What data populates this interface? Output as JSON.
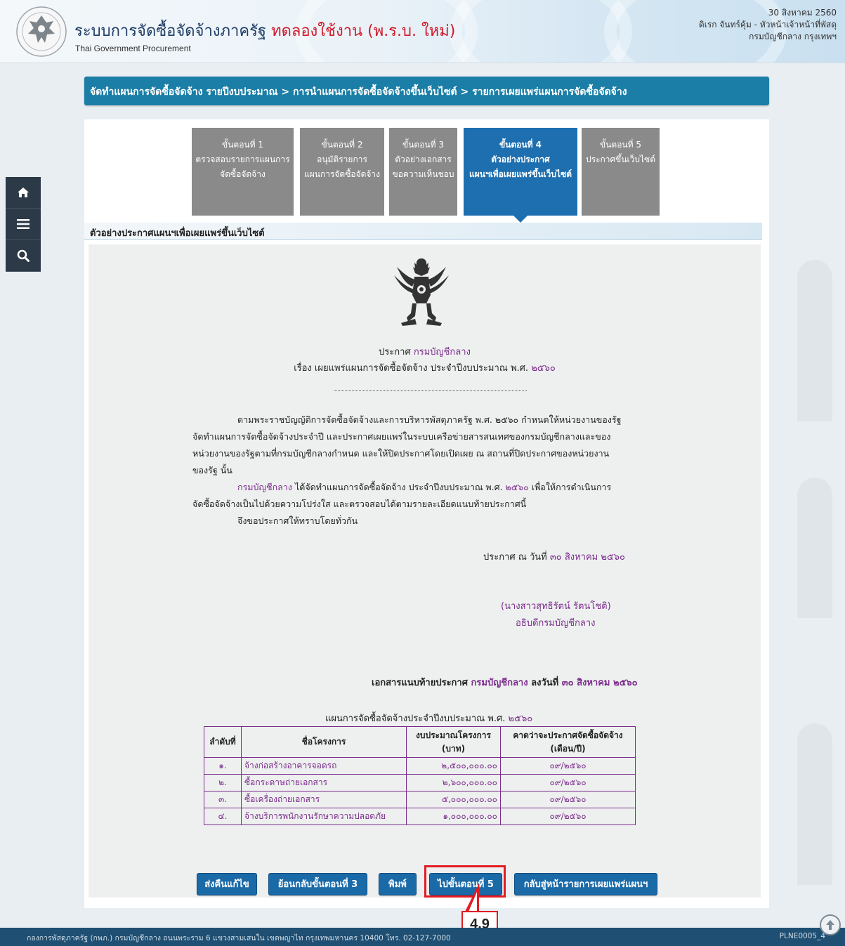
{
  "header": {
    "title": "ระบบการจัดซื้อจัดจ้างภาครัฐ",
    "trial_label": "ทดลองใช้งาน (พ.ร.บ. ใหม่)",
    "subtitle": "Thai Government Procurement",
    "date": "30 สิงหาคม 2560",
    "user": "ดิเรก จันทร์คุ้ม - หัวหน้าเจ้าหน้าที่พัสดุ",
    "org": "กรมบัญชีกลาง กรุงเทพฯ"
  },
  "nav": {
    "home_icon": "home-icon",
    "menu_icon": "menu-icon",
    "search_icon": "search-icon"
  },
  "breadcrumb": "จัดทำแผนการจัดซื้อจัดจ้าง รายปีงบประมาณ > การนำแผนการจัดซื้อจัดจ้างขึ้นเว็บไซต์ > รายการเผยแพร่แผนการจัดซื้อจัดจ้าง",
  "steps": [
    {
      "title": "ขั้นตอนที่ 1",
      "line1": "ตรวจสอบรายการแผนการ",
      "line2": "จัดซื้อจัดจ้าง"
    },
    {
      "title": "ขั้นตอนที่ 2",
      "line1": "อนุมัติรายการ",
      "line2": "แผนการจัดซื้อจัดจ้าง"
    },
    {
      "title": "ขั้นตอนที่ 3",
      "line1": "ตัวอย่างเอกสาร",
      "line2": "ขอความเห็นชอบ"
    },
    {
      "title": "ขั้นตอนที่ 4",
      "line1": "ตัวอย่างประกาศ",
      "line2": "แผนฯเพื่อเผยแพร่ขึ้นเว็บไซต์"
    },
    {
      "title": "ขั้นตอนที่ 5",
      "line1": "ประกาศขึ้นเว็บไซต์",
      "line2": ""
    }
  ],
  "section_title": "ตัวอย่างประกาศแผนฯเพื่อเผยแพร่ขึ้นเว็บไซต์",
  "doc": {
    "announce_prefix": "ประกาศ",
    "agency": "กรมบัญชีกลาง",
    "subject": "เรื่อง เผยแพร่แผนการจัดซื้อจัดจ้าง ประจำปีงบประมาณ พ.ศ.",
    "year": "๒๕๖๐",
    "p1_l1": "ตามพระราชบัญญัติการจัดซื้อจัดจ้างและการบริหารพัสดุภาครัฐ พ.ศ. ๒๕๖๐ กำหนดให้หน่วยงานของรัฐ",
    "p1_l2": "จัดทำแผนการจัดซื้อจัดจ้างประจำปี และประกาศเผยแพร่ในระบบเครือข่ายสารสนเทศของกรมบัญชีกลางและของ",
    "p1_l3": "หน่วยงานของรัฐตามที่กรมบัญชีกลางกำหนด และให้ปิดประกาศโดยเปิดเผย ณ สถานที่ปิดประกาศของหน่วยงาน",
    "p1_l4": "ของรัฐ นั้น",
    "p2_agency": "กรมบัญชีกลาง",
    "p2_l1": "ได้จัดทำแผนการจัดซื้อจัดจ้าง ประจำปีงบประมาณ พ.ศ.",
    "p2_year": "๒๕๖๐",
    "p2_l1_end": "เพื่อให้การดำเนินการ",
    "p2_l2": "จัดซื้อจัดจ้างเป็นไปด้วยความโปร่งใส และตรวจสอบได้ตามรายละเอียดแนบท้ายประกาศนี้",
    "p3": "จึงขอประกาศให้ทราบโดยทั่วกัน",
    "date_prefix": "ประกาศ ณ วันที่",
    "date_value": "๓๐ สิงหาคม ๒๕๖๐",
    "signer_name": "(นางสาวสุทธิรัตน์ รัตนโชติ)",
    "signer_title": "อธิบดีกรมบัญชีกลาง",
    "attach_prefix": "เอกสารแนบท้ายประกาศ",
    "attach_agency": "กรมบัญชีกลาง",
    "attach_date_prefix": "ลงวันที่",
    "attach_date": "๓๐ สิงหาคม ๒๕๖๐",
    "table_title": "แผนการจัดซื้อจัดจ้างประจำปีงบประมาณ พ.ศ.",
    "table_year": "๒๕๖๐"
  },
  "table": {
    "headers": {
      "no": "ลำดับที่",
      "name": "ชื่อโครงการ",
      "budget_l1": "งบประมาณโครงการ",
      "budget_l2": "(บาท)",
      "expected_l1": "คาดว่าจะประกาศจัดซื้อจัดจ้าง",
      "expected_l2": "(เดือน/ปี)"
    },
    "rows": [
      {
        "no": "๑.",
        "name": "จ้างก่อสร้างอาคารจอดรถ",
        "budget": "๒,๕๐๐,๐๐๐.๐๐",
        "expected": "๐๙/๒๕๖๐"
      },
      {
        "no": "๒.",
        "name": "ซื้อกระดาษถ่ายเอกสาร",
        "budget": "๒,๖๐๐,๐๐๐.๐๐",
        "expected": "๐๙/๒๕๖๐"
      },
      {
        "no": "๓.",
        "name": "ซื้อเครื่องถ่ายเอกสาร",
        "budget": "๕,๐๐๐,๐๐๐.๐๐",
        "expected": "๐๙/๒๕๖๐"
      },
      {
        "no": "๔.",
        "name": "จ้างบริการพนักงานรักษาความปลอดภัย",
        "budget": "๑,๐๐๐,๐๐๐.๐๐",
        "expected": "๐๙/๒๕๖๐"
      }
    ]
  },
  "buttons": {
    "return_edit": "ส่งคืนแก้ไข",
    "back_step3": "ย้อนกลับขั้นตอนที่ 3",
    "print": "พิมพ์",
    "next_step5": "ไปขั้นตอนที่ 5",
    "back_list": "กลับสู่หน้ารายการเผยแพร่แผนฯ"
  },
  "callout": "4.9",
  "footer": {
    "address": "กองการพัสดุภาครัฐ (กพภ.) กรมบัญชีกลาง ถนนพระราม 6 แขวงสามเสนใน เขตพญาไท กรุงเทพมหานคร 10400 โทร. 02-127-7000",
    "page_code": "PLNE0005_4"
  },
  "colors": {
    "accent": "#1b7ea6",
    "active_step": "#1e6fb0",
    "inactive_step": "#8a8a8a",
    "purple_text": "#7a2c8a",
    "highlight": "#e31c23"
  }
}
